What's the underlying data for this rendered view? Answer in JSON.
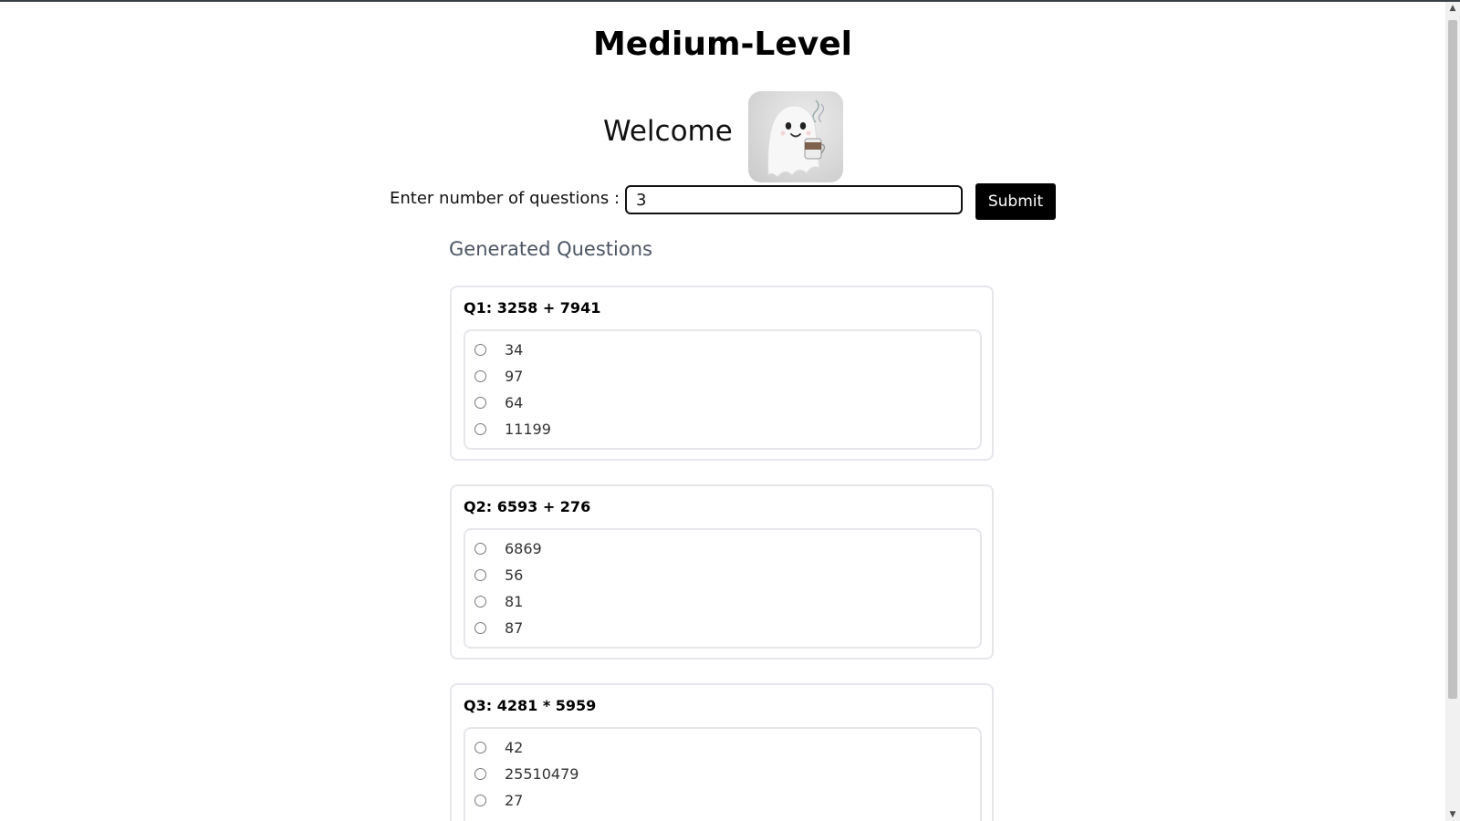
{
  "header": {
    "title": "Medium-Level"
  },
  "welcome": {
    "text": "Welcome",
    "mascot": "ghost-with-coffee"
  },
  "form": {
    "label": "Enter number of questions :",
    "input_value": "3",
    "submit_label": "Submit"
  },
  "generated": {
    "heading": "Generated Questions",
    "questions": [
      {
        "num": "Q1:",
        "expr": "3258 + 7941",
        "options": [
          "34",
          "97",
          "64",
          "11199"
        ]
      },
      {
        "num": "Q2:",
        "expr": "6593 + 276",
        "options": [
          "6869",
          "56",
          "81",
          "87"
        ]
      },
      {
        "num": "Q3:",
        "expr": "4281 * 5959",
        "options": [
          "42",
          "25510479",
          "27"
        ]
      }
    ]
  },
  "colors": {
    "accent": "#000000",
    "muted_heading": "#4b5563",
    "card_border": "#e5e7eb"
  }
}
